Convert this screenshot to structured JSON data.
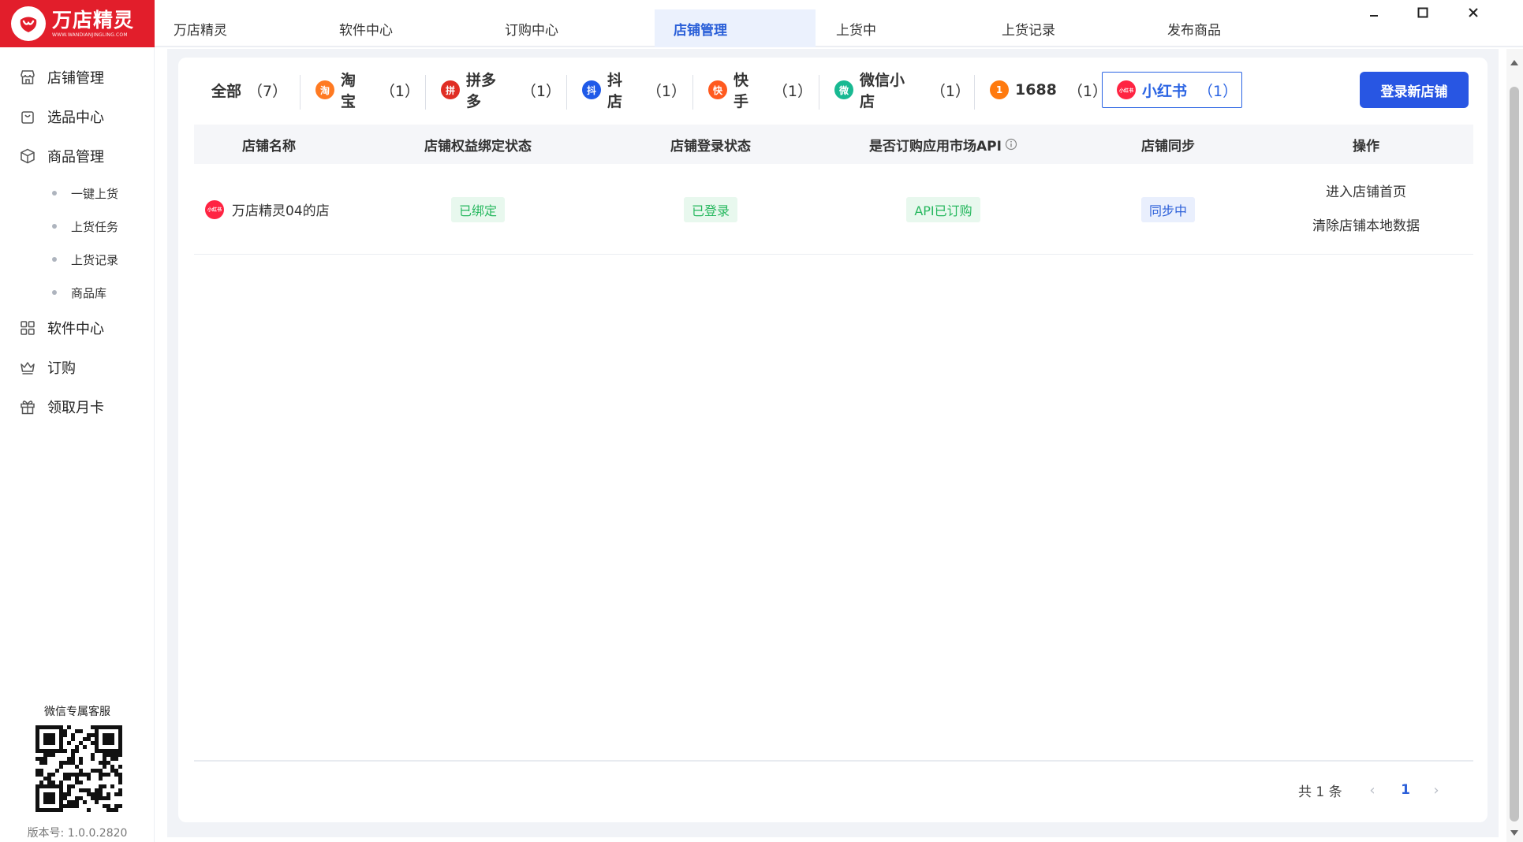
{
  "app": {
    "logo_text": "万店精灵",
    "logo_subtext": "WWW.WANDIANJINGLING.COM"
  },
  "topbar": {
    "tabs": [
      {
        "label": "万店精灵",
        "active": false
      },
      {
        "label": "软件中心",
        "active": false
      },
      {
        "label": "订购中心",
        "active": false
      },
      {
        "label": "店铺管理",
        "active": true
      },
      {
        "label": "上货中",
        "active": false
      },
      {
        "label": "上货记录",
        "active": false
      },
      {
        "label": "发布商品",
        "active": false
      }
    ]
  },
  "sidebar": {
    "items": [
      {
        "label": "店铺管理",
        "icon": "store-icon"
      },
      {
        "label": "选品中心",
        "icon": "shopping-bag-icon"
      },
      {
        "label": "商品管理",
        "icon": "box-icon"
      },
      {
        "label": "软件中心",
        "icon": "grid-apps-icon"
      },
      {
        "label": "订购",
        "icon": "crown-icon"
      },
      {
        "label": "领取月卡",
        "icon": "gift-icon"
      }
    ],
    "sub_items": [
      "一键上货",
      "上货任务",
      "上货记录",
      "商品库"
    ],
    "qr_title": "微信专属客服",
    "version": "版本号: 1.0.0.2820"
  },
  "platform_tabs": [
    {
      "label": "全部",
      "count": "（7）",
      "icon": null,
      "active": false
    },
    {
      "label": "淘宝",
      "count": "（1）",
      "icon": "taobao-icon",
      "icon_char": "淘",
      "color": "#ff7a22",
      "active": false
    },
    {
      "label": "拼多多",
      "count": "（1）",
      "icon": "pinduoduo-icon",
      "icon_char": "拼",
      "color": "#e02e24",
      "active": false
    },
    {
      "label": "抖店",
      "count": "（1）",
      "icon": "douyin-shop-icon",
      "icon_char": "抖",
      "color": "#1f5ae8",
      "active": false
    },
    {
      "label": "快手",
      "count": "（1）",
      "icon": "kuaishou-icon",
      "icon_char": "快",
      "color": "#ff5a1f",
      "active": false
    },
    {
      "label": "微信小店",
      "count": "（1）",
      "icon": "wechat-shop-icon",
      "icon_char": "微",
      "color": "#19b992",
      "active": false
    },
    {
      "label": "1688",
      "count": "（1）",
      "icon": "alibaba-1688-icon",
      "icon_char": "1",
      "color": "#ff7a0e",
      "active": false
    },
    {
      "label": "小红书",
      "count": "（1）",
      "icon": "xiaohongshu-icon",
      "icon_char": "小红书",
      "color": "#ff2442",
      "active": true
    }
  ],
  "login_button": "登录新店铺",
  "table": {
    "headers": [
      "店铺名称",
      "店铺权益绑定状态",
      "店铺登录状态",
      "是否订购应用市场API",
      "店铺同步",
      "操作"
    ],
    "rows": [
      {
        "shop_name": "万店精灵04的店",
        "shop_icon_text": "小红书",
        "bind_status": "已绑定",
        "login_status": "已登录",
        "api_status": "API已订购",
        "sync_status": "同步中",
        "actions": [
          "进入店铺首页",
          "清除店铺本地数据"
        ]
      }
    ]
  },
  "pagination": {
    "total": "共 1 条",
    "current_page": "1",
    "prev": "‹",
    "next": "›"
  },
  "colors": {
    "brand_red": "#e21e2b",
    "primary_blue": "#2856e3",
    "success_green": "#27b85f"
  }
}
